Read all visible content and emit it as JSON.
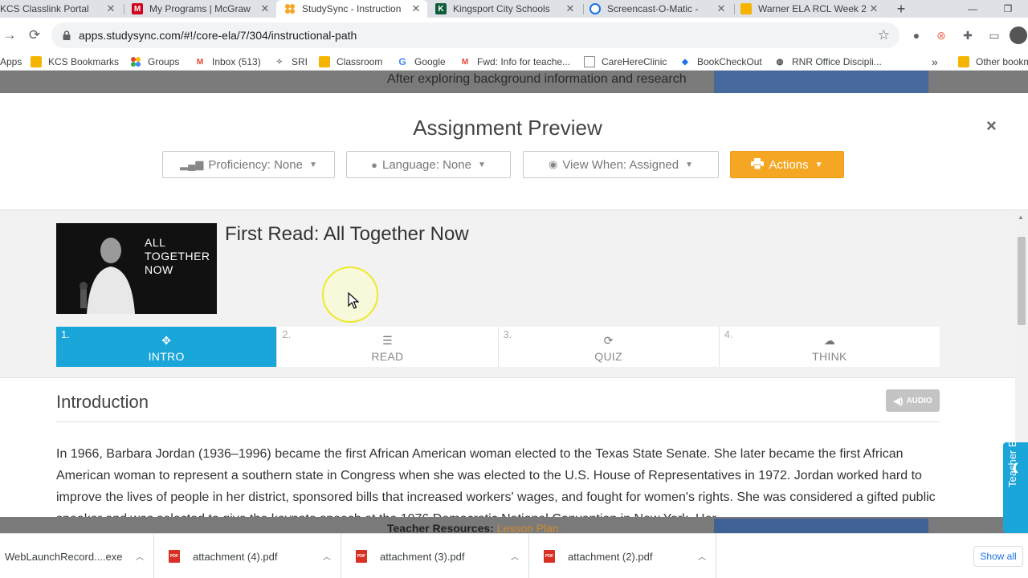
{
  "browser": {
    "tabs": [
      {
        "title": "KCS Classlink Portal",
        "icon": "classlink-icon",
        "color": "#2b7bd8",
        "active": false
      },
      {
        "title": "My Programs | McGraw",
        "icon": "mcgraw-icon",
        "color": "#d0021b",
        "active": false
      },
      {
        "title": "StudySync - Instruction",
        "icon": "studysync-icon",
        "color": "#f5a623",
        "active": true
      },
      {
        "title": "Kingsport City Schools",
        "icon": "kingsport-icon",
        "color": "#0f5c3a",
        "active": false
      },
      {
        "title": "Screencast-O-Matic -",
        "icon": "screencast-icon",
        "color": "#1a73e8",
        "active": false
      },
      {
        "title": "Warner ELA RCL Week 2",
        "icon": "slides-icon",
        "color": "#f4b400",
        "active": false
      }
    ],
    "url": "apps.studysync.com/#!/core-ela/7/304/instructional-path",
    "bookmarks": [
      {
        "label": "Apps",
        "icon": "apps-grid-icon"
      },
      {
        "label": "KCS Bookmarks",
        "icon": "folder-icon"
      },
      {
        "label": "Groups",
        "icon": "groups-icon"
      },
      {
        "label": "Inbox (513)",
        "icon": "gmail-icon"
      },
      {
        "label": "SRI",
        "icon": "sri-icon"
      },
      {
        "label": "Classroom",
        "icon": "classroom-icon"
      },
      {
        "label": "Google",
        "icon": "google-icon"
      },
      {
        "label": "Fwd: Info for teache...",
        "icon": "gmail-icon"
      },
      {
        "label": "CareHereClinic",
        "icon": "document-icon"
      },
      {
        "label": "BookCheckOut",
        "icon": "diamond-icon"
      },
      {
        "label": "RNR Office Discipli...",
        "icon": "globe-icon"
      }
    ],
    "bookmarks_overflow": "»",
    "other_bookmarks": "Other bookmarks"
  },
  "background_page": {
    "card_text": "After exploring background information and research",
    "footer_label": "Teacher Resources:",
    "footer_link": "Lesson Plan"
  },
  "modal": {
    "title": "Assignment Preview",
    "close": "×",
    "controls": [
      {
        "label": "Proficiency: None",
        "icon": "signal-bars-icon"
      },
      {
        "label": "Language: None",
        "icon": "globe-icon"
      },
      {
        "label": "View When: Assigned",
        "icon": "eye-icon"
      },
      {
        "label": "Actions",
        "icon": "printer-icon"
      }
    ],
    "lesson": {
      "title": "First Read: All Together Now",
      "thumbnail_text": [
        "ALL",
        "TOGETHER",
        "NOW"
      ]
    },
    "steps": [
      {
        "num": "1.",
        "label": "INTRO",
        "icon": "intro-icon",
        "active": true
      },
      {
        "num": "2.",
        "label": "READ",
        "icon": "lines-icon",
        "active": false
      },
      {
        "num": "3.",
        "label": "QUIZ",
        "icon": "refresh-icon",
        "active": false
      },
      {
        "num": "4.",
        "label": "THINK",
        "icon": "cloud-icon",
        "active": false
      }
    ],
    "section_title": "Introduction",
    "audio_label": "AUDIO",
    "intro_text": "In 1966, Barbara Jordan (1936–1996) became the first African American woman elected to the Texas State Senate. She later became the first African American woman to represent a southern state in Congress when she was elected to the U.S. House of Representatives in 1972. Jordan worked hard to improve the lives of people in her district, sponsored bills that increased workers' wages, and fought for women's rights. She was considered a gifted public speaker and was selected to give the keynote speech at the 1976 Democratic National Convention in New York. Her"
  },
  "teacher_edition_tab": "Teacher Edition",
  "downloads": {
    "items": [
      {
        "name": "WebLaunchRecord....exe",
        "type": "exe"
      },
      {
        "name": "attachment (4).pdf",
        "type": "pdf"
      },
      {
        "name": "attachment (3).pdf",
        "type": "pdf"
      },
      {
        "name": "attachment (2).pdf",
        "type": "pdf"
      }
    ],
    "show_all": "Show all"
  },
  "colors": {
    "studysync_blue": "#1ba6d9",
    "actions_orange": "#f5a623",
    "chrome_tabstrip": "#dee1e6"
  }
}
